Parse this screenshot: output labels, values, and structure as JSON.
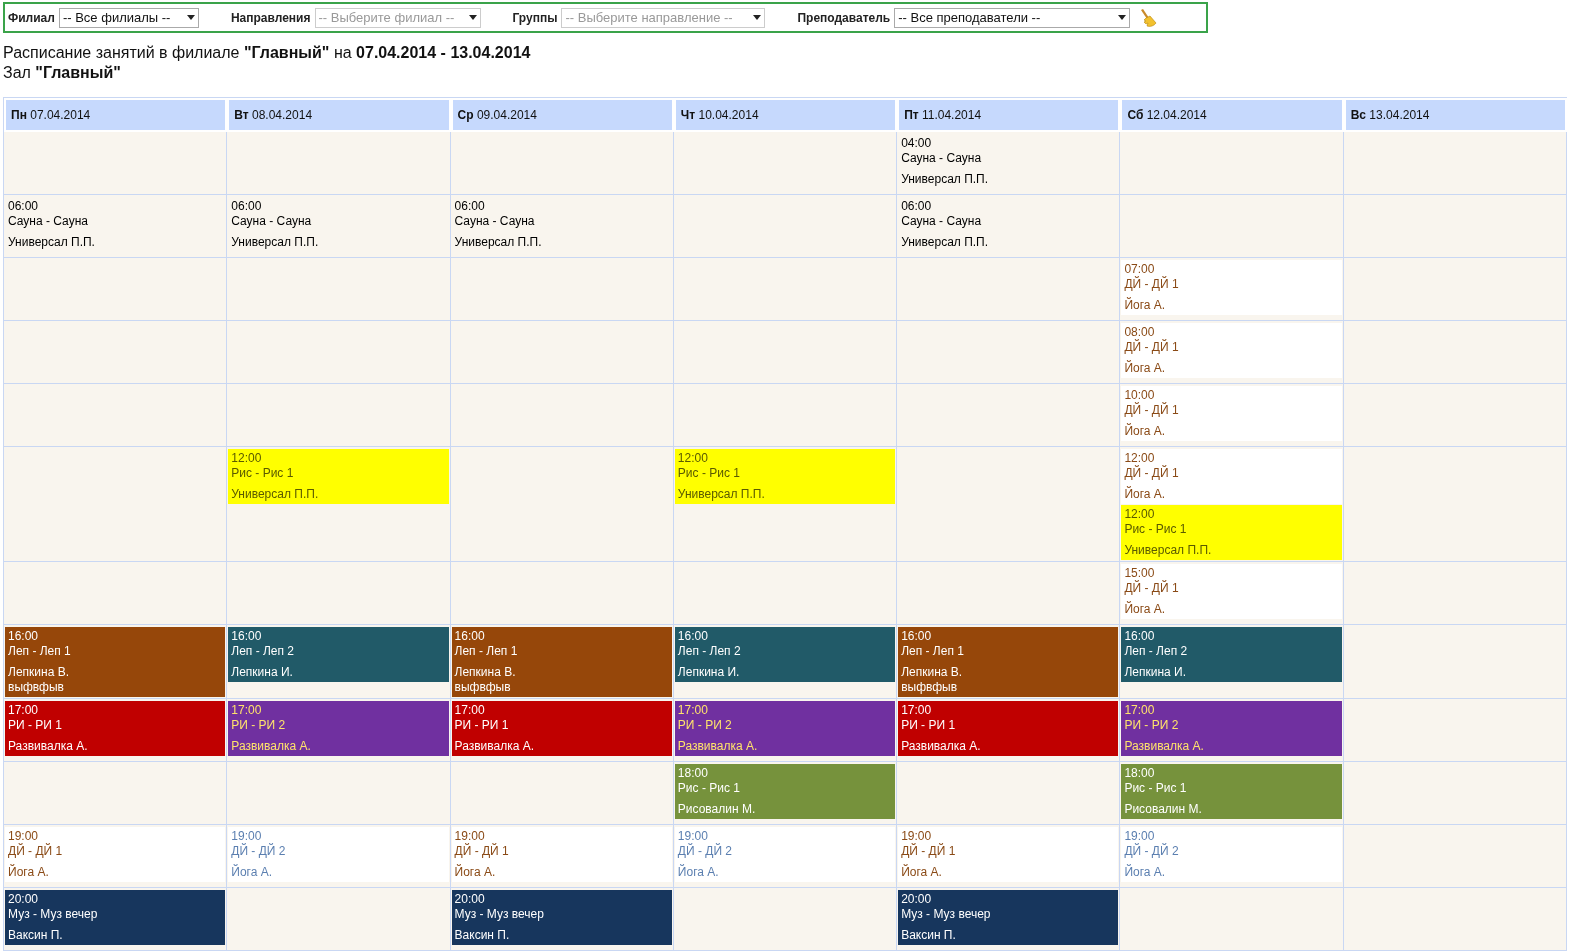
{
  "filters": [
    {
      "label": "Филиал",
      "value": "-- Все филиалы --",
      "disabled": false
    },
    {
      "label": "Направления",
      "value": "-- Выберите филиал --",
      "disabled": true
    },
    {
      "label": "Группы",
      "value": "-- Выберите направление --",
      "disabled": true
    },
    {
      "label": "Преподаватель",
      "value": "-- Все преподаватели --",
      "disabled": false
    }
  ],
  "heading": "Расписание занятий в филиале **\"Главный\"** на **07.04.2014 - 13.04.2014**",
  "hall": "Зал **\"Главный\"**",
  "days": [
    "**Пн** 07.04.2014",
    "**Вт** 08.04.2014",
    "**Ср** 09.04.2014",
    "**Чт** 10.04.2014",
    "**Пт** 11.04.2014",
    "**Сб** 12.04.2014",
    "**Вс** 13.04.2014"
  ],
  "rows": [
    [
      {},
      {},
      {},
      {},
      {
        "events": [
          {
            "time": "04:00",
            "group": "Сауна - Сауна",
            "teacher": "Универсал П.П.",
            "color": "#f9f5ee",
            "kind": "plain"
          }
        ]
      },
      {},
      {}
    ],
    [
      {
        "events": [
          {
            "time": "06:00",
            "group": "Сауна - Сауна",
            "teacher": "Универсал П.П.",
            "color": "#f9f5ee",
            "kind": "plain"
          }
        ]
      },
      {
        "events": [
          {
            "time": "06:00",
            "group": "Сауна - Сауна",
            "teacher": "Универсал П.П.",
            "color": "#f9f5ee",
            "kind": "plain"
          }
        ]
      },
      {
        "events": [
          {
            "time": "06:00",
            "group": "Сауна - Сауна",
            "teacher": "Универсал П.П.",
            "color": "#f9f5ee",
            "kind": "plain"
          }
        ]
      },
      {},
      {
        "events": [
          {
            "time": "06:00",
            "group": "Сауна - Сауна",
            "teacher": "Универсал П.П.",
            "color": "#f9f5ee",
            "kind": "plain"
          }
        ]
      },
      {},
      {}
    ],
    [
      {},
      {},
      {},
      {},
      {},
      {
        "events": [
          {
            "time": "07:00",
            "group": "ДЙ - ДЙ 1",
            "teacher": "Йога А.",
            "color": "#ffffff",
            "kind": "warm"
          }
        ]
      },
      {}
    ],
    [
      {},
      {},
      {},
      {},
      {},
      {
        "events": [
          {
            "time": "08:00",
            "group": "ДЙ - ДЙ 1",
            "teacher": "Йога А.",
            "color": "#ffffff",
            "kind": "warm"
          }
        ]
      },
      {}
    ],
    [
      {},
      {},
      {},
      {},
      {},
      {
        "events": [
          {
            "time": "10:00",
            "group": "ДЙ - ДЙ 1",
            "teacher": "Йога А.",
            "color": "#ffffff",
            "kind": "warm"
          }
        ]
      },
      {}
    ],
    [
      {},
      {
        "events": [
          {
            "time": "12:00",
            "group": "Рис - Рис 1",
            "teacher": "Универсал П.П.",
            "color": "#ffff00",
            "kind": "olive"
          }
        ]
      },
      {},
      {
        "events": [
          {
            "time": "12:00",
            "group": "Рис - Рис 1",
            "teacher": "Универсал П.П.",
            "color": "#ffff00",
            "kind": "olive"
          }
        ]
      },
      {},
      {
        "events": [
          {
            "time": "12:00",
            "group": "ДЙ - ДЙ 1",
            "teacher": "Йога А.",
            "color": "#ffffff",
            "kind": "warm"
          },
          {
            "time": "12:00",
            "group": "Рис - Рис 1",
            "teacher": "Универсал П.П.",
            "color": "#ffff00",
            "kind": "olive"
          }
        ]
      },
      {}
    ],
    [
      {},
      {},
      {},
      {},
      {},
      {
        "events": [
          {
            "time": "15:00",
            "group": "ДЙ - ДЙ 1",
            "teacher": "Йога А.",
            "color": "#ffffff",
            "kind": "warm"
          }
        ]
      },
      {}
    ],
    [
      {
        "events": [
          {
            "time": "16:00",
            "group": "Леп - Леп 1",
            "teacher": "Лепкина В.",
            "note": "выфвфыв",
            "color": "#96470a",
            "kind": "light"
          }
        ]
      },
      {
        "events": [
          {
            "time": "16:00",
            "group": "Леп - Леп 2",
            "teacher": "Лепкина И.",
            "color": "#215a68",
            "kind": "light"
          }
        ]
      },
      {
        "events": [
          {
            "time": "16:00",
            "group": "Леп - Леп 1",
            "teacher": "Лепкина В.",
            "note": "выфвфыв",
            "color": "#96470a",
            "kind": "light"
          }
        ]
      },
      {
        "events": [
          {
            "time": "16:00",
            "group": "Леп - Леп 2",
            "teacher": "Лепкина И.",
            "color": "#215a68",
            "kind": "light"
          }
        ]
      },
      {
        "events": [
          {
            "time": "16:00",
            "group": "Леп - Леп 1",
            "teacher": "Лепкина В.",
            "note": "выфвфыв",
            "color": "#96470a",
            "kind": "light"
          }
        ]
      },
      {
        "events": [
          {
            "time": "16:00",
            "group": "Леп - Леп 2",
            "teacher": "Лепкина И.",
            "color": "#215a68",
            "kind": "light"
          }
        ]
      },
      {}
    ],
    [
      {
        "events": [
          {
            "time": "17:00",
            "group": "РИ - РИ 1",
            "teacher": "Развивалка А.",
            "color": "#c00000",
            "kind": "light"
          }
        ]
      },
      {
        "events": [
          {
            "time": "17:00",
            "group": "РИ - РИ 2",
            "teacher": "Развивалка А.",
            "color": "#7030a0",
            "kind": "gold"
          }
        ]
      },
      {
        "events": [
          {
            "time": "17:00",
            "group": "РИ - РИ 1",
            "teacher": "Развивалка А.",
            "color": "#c00000",
            "kind": "light"
          }
        ]
      },
      {
        "events": [
          {
            "time": "17:00",
            "group": "РИ - РИ 2",
            "teacher": "Развивалка А.",
            "color": "#7030a0",
            "kind": "gold"
          }
        ]
      },
      {
        "events": [
          {
            "time": "17:00",
            "group": "РИ - РИ 1",
            "teacher": "Развивалка А.",
            "color": "#c00000",
            "kind": "light"
          }
        ]
      },
      {
        "events": [
          {
            "time": "17:00",
            "group": "РИ - РИ 2",
            "teacher": "Развивалка А.",
            "color": "#7030a0",
            "kind": "gold"
          }
        ]
      },
      {}
    ],
    [
      {},
      {},
      {},
      {
        "events": [
          {
            "time": "18:00",
            "group": "Рис - Рис 1",
            "teacher": "Рисовалин М.",
            "color": "#76923c",
            "kind": "light"
          }
        ]
      },
      {},
      {
        "events": [
          {
            "time": "18:00",
            "group": "Рис - Рис 1",
            "teacher": "Рисовалин М.",
            "color": "#76923c",
            "kind": "light"
          }
        ]
      },
      {}
    ],
    [
      {
        "events": [
          {
            "time": "19:00",
            "group": "ДЙ - ДЙ 1",
            "teacher": "Йога А.",
            "color": "#ffffff",
            "kind": "warm"
          }
        ]
      },
      {
        "events": [
          {
            "time": "19:00",
            "group": "ДЙ - ДЙ 2",
            "teacher": "Йога А.",
            "color": "#ffffff",
            "kind": "cool"
          }
        ]
      },
      {
        "events": [
          {
            "time": "19:00",
            "group": "ДЙ - ДЙ 1",
            "teacher": "Йога А.",
            "color": "#ffffff",
            "kind": "warm"
          }
        ]
      },
      {
        "events": [
          {
            "time": "19:00",
            "group": "ДЙ - ДЙ 2",
            "teacher": "Йога А.",
            "color": "#ffffff",
            "kind": "cool"
          }
        ]
      },
      {
        "events": [
          {
            "time": "19:00",
            "group": "ДЙ - ДЙ 1",
            "teacher": "Йога А.",
            "color": "#ffffff",
            "kind": "warm"
          }
        ]
      },
      {
        "events": [
          {
            "time": "19:00",
            "group": "ДЙ - ДЙ 2",
            "teacher": "Йога А.",
            "color": "#ffffff",
            "kind": "cool"
          }
        ]
      },
      {}
    ],
    [
      {
        "events": [
          {
            "time": "20:00",
            "group": "Муз - Муз вечер",
            "teacher": "Ваксин П.",
            "color": "#17365d",
            "kind": "light"
          }
        ]
      },
      {},
      {
        "events": [
          {
            "time": "20:00",
            "group": "Муз - Муз вечер",
            "teacher": "Ваксин П.",
            "color": "#17365d",
            "kind": "light"
          }
        ]
      },
      {},
      {
        "events": [
          {
            "time": "20:00",
            "group": "Муз - Муз вечер",
            "teacher": "Ваксин П.",
            "color": "#17365d",
            "kind": "light"
          }
        ]
      },
      {},
      {}
    ]
  ]
}
